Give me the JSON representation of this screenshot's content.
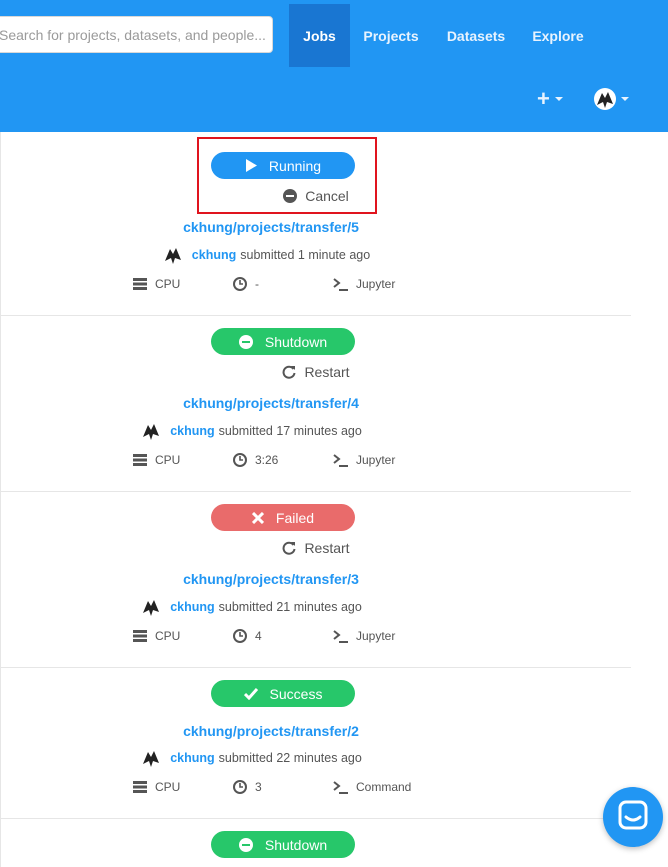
{
  "header": {
    "search": {
      "placeholder": "Search for projects, datasets, and people...",
      "value": ""
    },
    "nav": [
      {
        "label": "Jobs",
        "active": true
      },
      {
        "label": "Projects",
        "active": false
      },
      {
        "label": "Datasets",
        "active": false
      },
      {
        "label": "Explore",
        "active": false
      }
    ],
    "colors": {
      "bar": "#2196f3",
      "active": "#1976d2"
    }
  },
  "jobs": [
    {
      "status": "Running",
      "status_color": "#2196f3",
      "status_icon": "play-icon",
      "action": "Cancel",
      "action_icon": "minus-circle-icon",
      "path": "ckhung/projects/transfer/5",
      "user": "ckhung",
      "submitted": "submitted 1 minute ago",
      "machine": "CPU",
      "duration": "-",
      "mode": "Jupyter"
    },
    {
      "status": "Shutdown",
      "status_color": "#27c76a",
      "status_icon": "minus-circle-icon",
      "action": "Restart",
      "action_icon": "restart-icon",
      "path": "ckhung/projects/transfer/4",
      "user": "ckhung",
      "submitted": "submitted 17 minutes ago",
      "machine": "CPU",
      "duration": "3:26",
      "mode": "Jupyter"
    },
    {
      "status": "Failed",
      "status_color": "#e96b6b",
      "status_icon": "x-icon",
      "action": "Restart",
      "action_icon": "restart-icon",
      "path": "ckhung/projects/transfer/3",
      "user": "ckhung",
      "submitted": "submitted 21 minutes ago",
      "machine": "CPU",
      "duration": "4",
      "mode": "Jupyter"
    },
    {
      "status": "Success",
      "status_color": "#27c76a",
      "status_icon": "check-icon",
      "path": "ckhung/projects/transfer/2",
      "user": "ckhung",
      "submitted": "submitted 22 minutes ago",
      "machine": "CPU",
      "duration": "3",
      "mode": "Command"
    },
    {
      "status": "Shutdown",
      "status_color": "#27c76a",
      "status_icon": "minus-circle-icon"
    }
  ]
}
